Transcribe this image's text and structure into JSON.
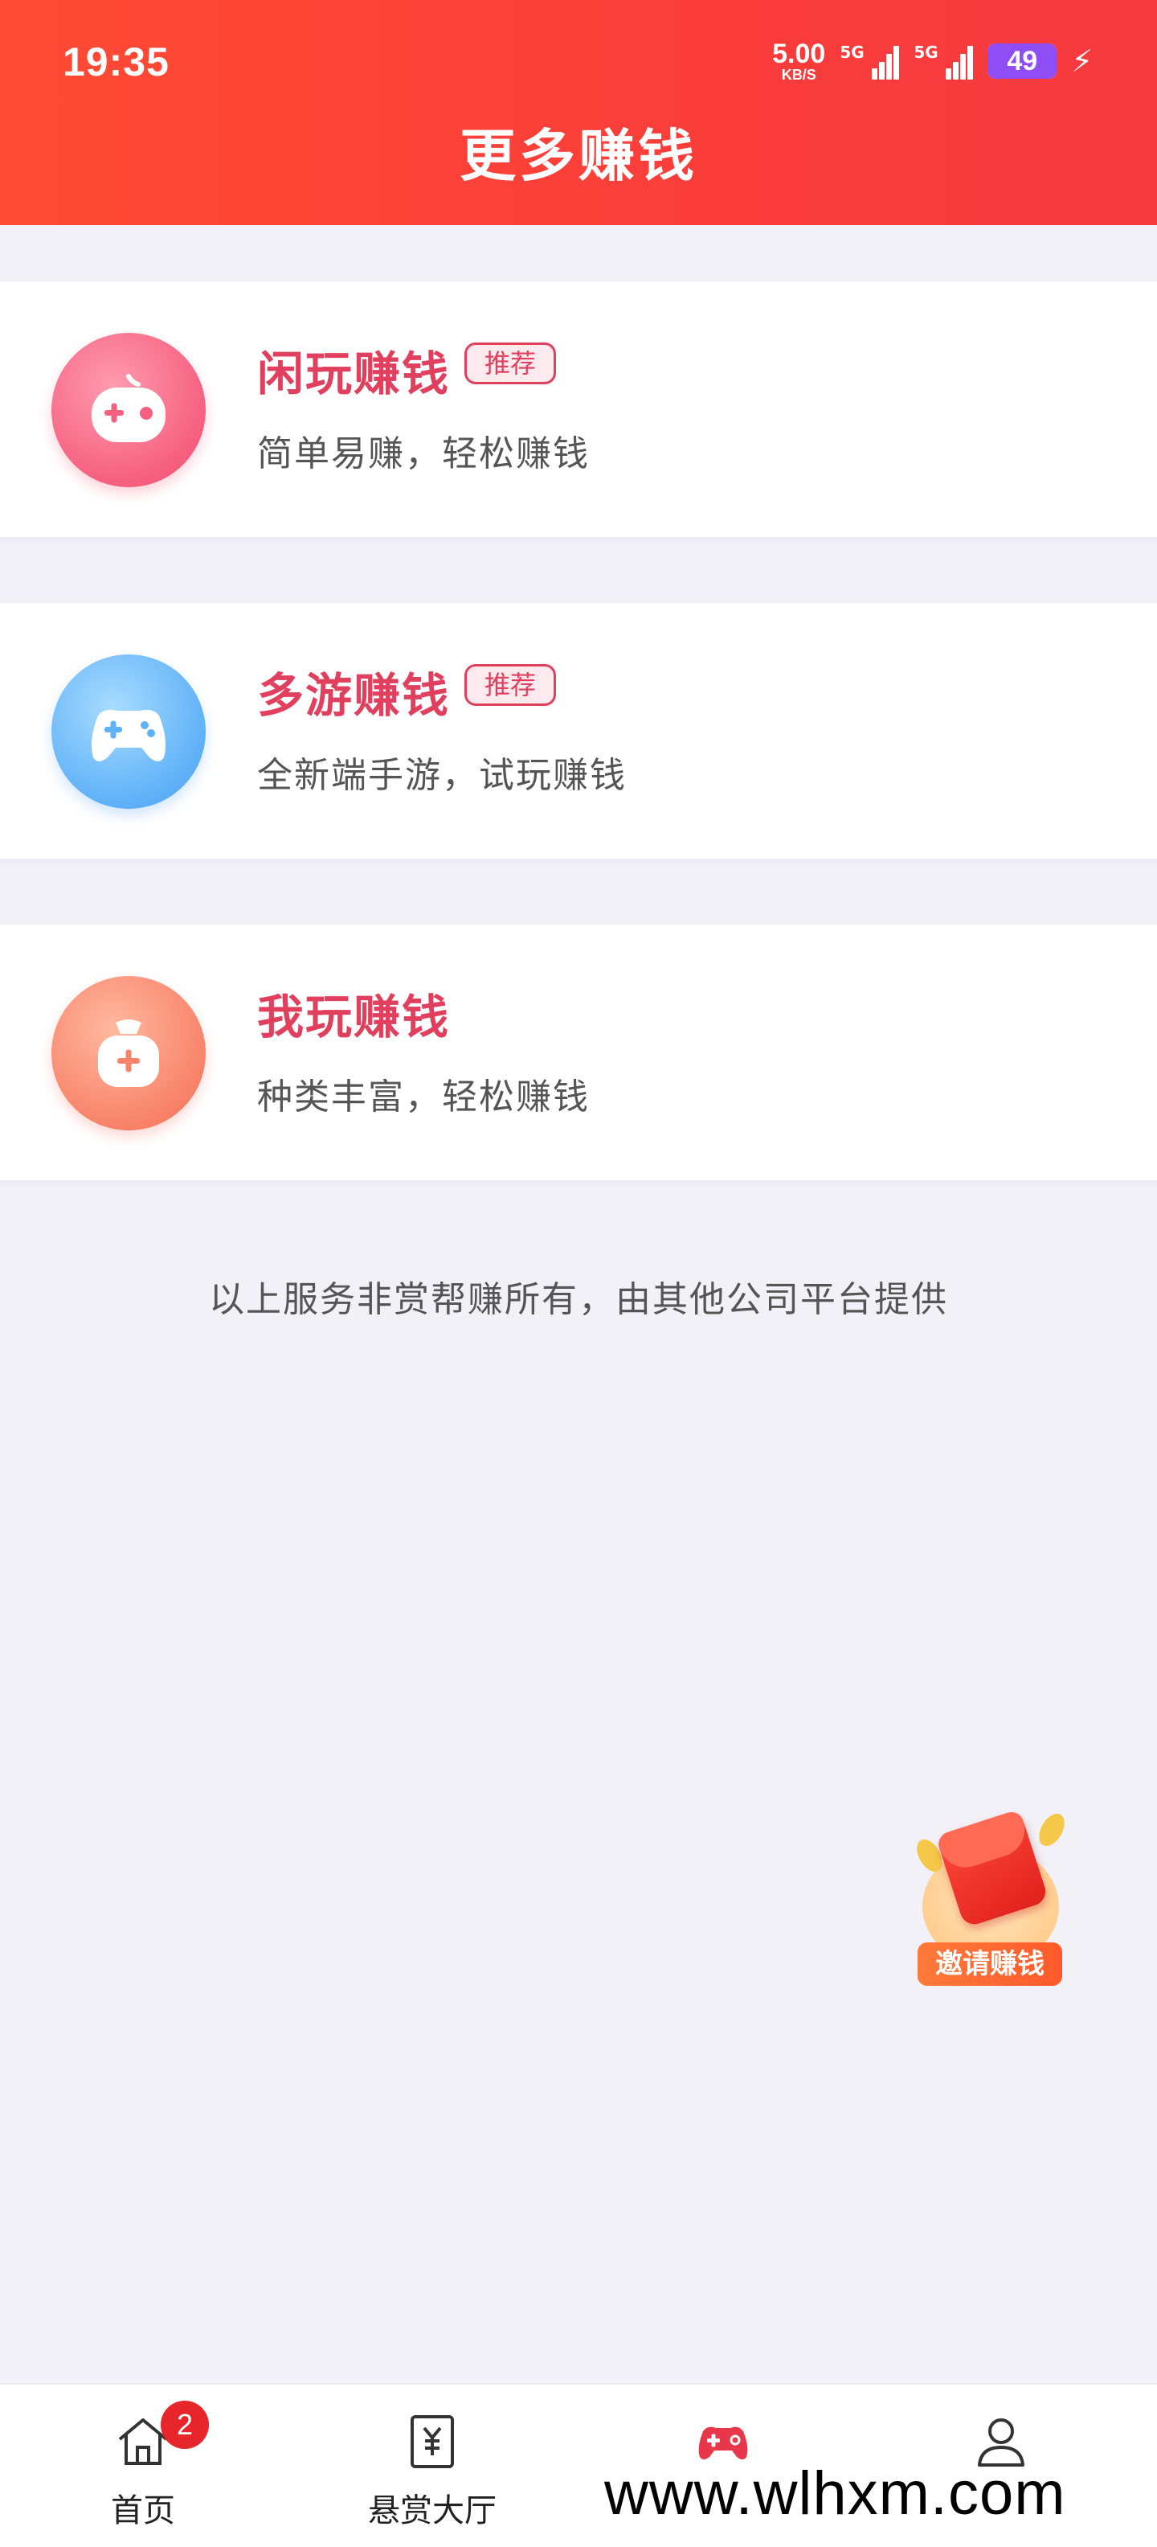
{
  "status_bar": {
    "time": "19:35",
    "net_speed": "5.00",
    "net_unit": "KB/S",
    "sim1_label": "5G",
    "sim2_label": "5G",
    "battery": "49",
    "battery_color": "#8f4df5",
    "charge_icon": "bolt-icon"
  },
  "header": {
    "title": "更多赚钱",
    "bg_color": "#fa3d3a"
  },
  "cards": [
    {
      "name": "闲玩赚钱",
      "badge": "推荐",
      "desc": "简单易赚，轻松赚钱",
      "icon": "gamepad-pink-icon",
      "accent": "#f55b7a"
    },
    {
      "name": "多游赚钱",
      "badge": "推荐",
      "desc": "全新端手游，试玩赚钱",
      "icon": "gamepad-blue-icon",
      "accent": "#4a9df5"
    },
    {
      "name": "我玩赚钱",
      "badge": "",
      "desc": "种类丰富，轻松赚钱",
      "icon": "moneybag-orange-icon",
      "accent": "#f7785e"
    }
  ],
  "notice": "以上服务非赏帮赚所有，由其他公司平台提供",
  "floating": {
    "label": "邀请赚钱",
    "icon": "red-envelope-icon"
  },
  "tabbar": {
    "items": [
      {
        "label": "首页",
        "icon": "home-icon",
        "badge": "2"
      },
      {
        "label": "悬赏大厅",
        "icon": "yuan-doc-icon"
      },
      {
        "label": "",
        "icon": "gamepad-icon",
        "active_color": "#e8364a"
      },
      {
        "label": "",
        "icon": "user-icon"
      }
    ]
  },
  "watermark": "www.wlhxm.com"
}
